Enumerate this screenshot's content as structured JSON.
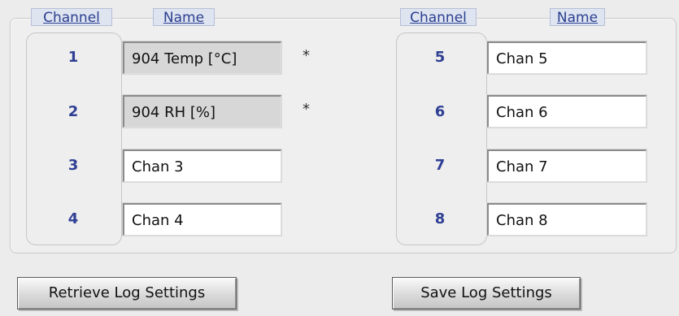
{
  "left_panel": {
    "channel_header": "Channel",
    "name_header": "Name",
    "rows": [
      {
        "channel": "1",
        "name": "904 Temp [°C]",
        "readonly": true,
        "asterisk": "*"
      },
      {
        "channel": "2",
        "name": "904 RH [%]",
        "readonly": true,
        "asterisk": "*"
      },
      {
        "channel": "3",
        "name": "Chan 3",
        "readonly": false,
        "asterisk": ""
      },
      {
        "channel": "4",
        "name": "Chan 4",
        "readonly": false,
        "asterisk": ""
      }
    ]
  },
  "right_panel": {
    "channel_header": "Channel",
    "name_header": "Name",
    "rows": [
      {
        "channel": "5",
        "name": "Chan 5",
        "readonly": false
      },
      {
        "channel": "6",
        "name": "Chan 6",
        "readonly": false
      },
      {
        "channel": "7",
        "name": "Chan 7",
        "readonly": false
      },
      {
        "channel": "8",
        "name": "Chan 8",
        "readonly": false
      }
    ]
  },
  "buttons": {
    "retrieve": "Retrieve Log Settings",
    "save": "Save Log Settings"
  }
}
